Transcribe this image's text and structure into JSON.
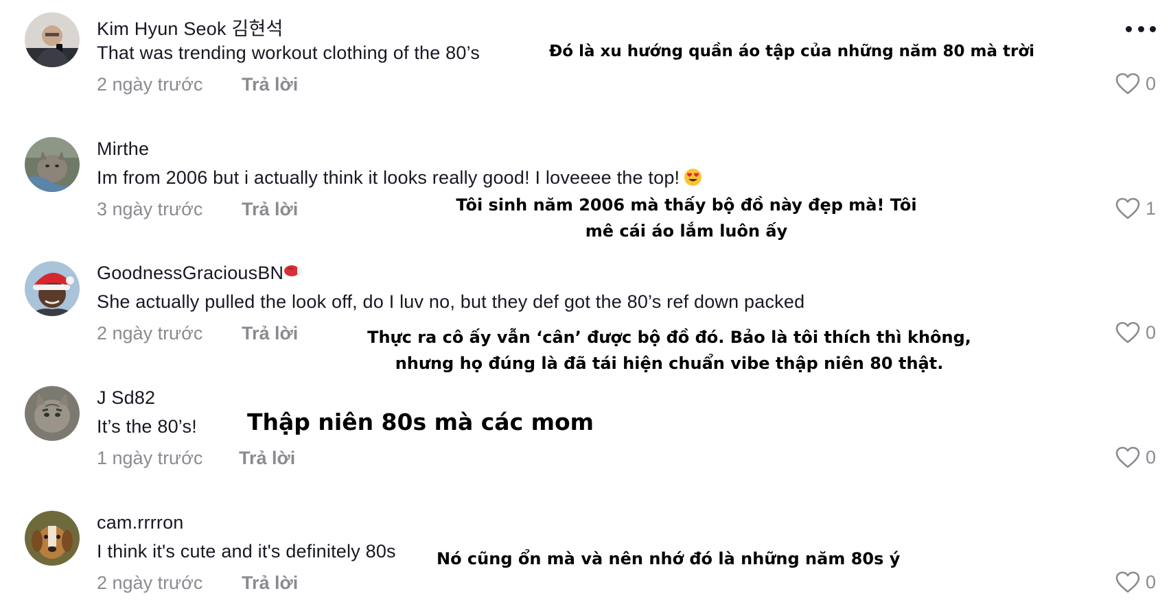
{
  "comments": [
    {
      "username": "Kim Hyun Seok 김현석",
      "text": "That was trending workout clothing of the 80’s",
      "time": "2 ngày trước",
      "reply": "Trả lời",
      "likes": "0",
      "overlay_lines": [
        "Đó là xu hướng quần áo tập của những năm 80 mà trời"
      ]
    },
    {
      "username": "Mirthe",
      "text": "Im from 2006 but i actually think it looks really good! I loveeee the top!",
      "time": "3 ngày trước",
      "reply": "Trả lời",
      "likes": "1",
      "overlay_lines": [
        "Tôi sinh năm 2006 mà thấy bộ đồ này đẹp mà! Tôi",
        "mê cái áo lắm luôn ấy"
      ]
    },
    {
      "username": "GoodnessGraciousBN",
      "text": "She actually pulled the look off, do I luv no, but they def got the 80’s ref down packed",
      "time": "2 ngày trước",
      "reply": "Trả lời",
      "likes": "0",
      "overlay_lines": [
        "Thực ra cô ấy vẫn ‘cân’ được bộ đồ đó. Bảo là tôi thích thì không,",
        "nhưng họ đúng là đã tái hiện chuẩn vibe thập niên 80 thật."
      ]
    },
    {
      "username": "J Sd82",
      "text": "It’s the 80’s!",
      "time": "1 ngày trước",
      "reply": "Trả lời",
      "likes": "0",
      "overlay_lines": [
        "Thập niên 80s mà các mom"
      ]
    },
    {
      "username": "cam.rrrron",
      "text": "I think it's cute and it's definitely 80s",
      "time": "2 ngày trước",
      "reply": "Trả lời",
      "likes": "0",
      "overlay_lines": [
        "Nó cũng ổn mà và nên nhớ đó là những năm 80s ý"
      ]
    }
  ],
  "icons": {
    "like": "heart-outline-icon",
    "more": "more-dots-icon",
    "emoji": "heart-eyes-emoji",
    "badge": "boxing-glove-emoji"
  },
  "colors": {
    "primary_text": "#161823",
    "secondary_text": "#8a8b91",
    "overlay_text": "#000000"
  }
}
